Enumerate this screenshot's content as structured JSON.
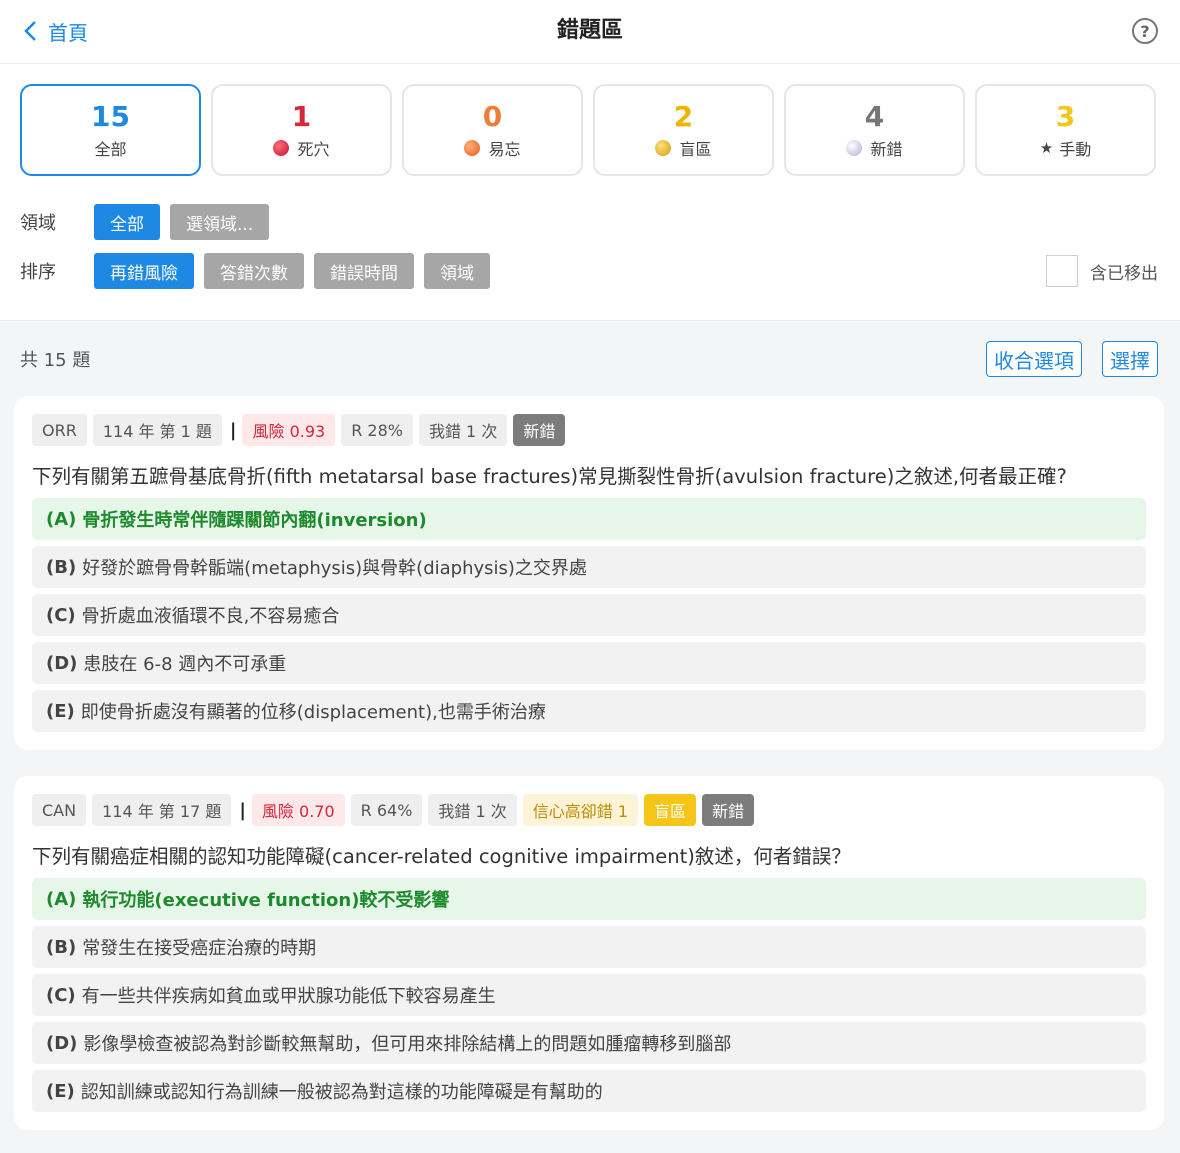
{
  "header": {
    "back_label": "首頁",
    "title": "錯題區",
    "help_glyph": "?"
  },
  "stats": [
    {
      "count": "15",
      "label": "全部",
      "color": "#1e88e5",
      "icon": "",
      "active": true
    },
    {
      "count": "1",
      "label": "死穴",
      "color": "#d8263a",
      "icon": "red-dot-icon"
    },
    {
      "count": "0",
      "label": "易忘",
      "color": "#f07b3a",
      "icon": "orange-dot-icon"
    },
    {
      "count": "2",
      "label": "盲區",
      "color": "#f0b400",
      "icon": "yellow-dot-icon"
    },
    {
      "count": "4",
      "label": "新錯",
      "color": "#777777",
      "icon": "purple-dot-icon"
    },
    {
      "count": "3",
      "label": "手動",
      "color": "#f5c518",
      "icon": "star-icon"
    }
  ],
  "filters": {
    "domain_label": "領域",
    "domain_options": [
      "全部",
      "選領域..."
    ],
    "sort_label": "排序",
    "sort_options": [
      "再錯風險",
      "答錯次數",
      "錯誤時間",
      "領域"
    ],
    "include_removed_label": "含已移出"
  },
  "list": {
    "count_text": "共 15 題",
    "collapse_label": "收合選項",
    "select_label": "選擇"
  },
  "cards": [
    {
      "tags": {
        "domain": "ORR",
        "source": "114 年 第 1 題",
        "risk": "風險 0.93",
        "r": "R 28%",
        "wrong": "我錯 1 次",
        "conf": "",
        "blind": "",
        "new": "新錯"
      },
      "question": "下列有關第五蹠骨基底骨折(fifth metatarsal base fractures)常見撕裂性骨折(avulsion fracture)之敘述,何者最正確?",
      "options": [
        {
          "key": "(A)",
          "text": "骨折發生時常伴隨踝關節內翻(inversion)"
        },
        {
          "key": "(B)",
          "text": "好發於蹠骨骨幹骺端(metaphysis)與骨幹(diaphysis)之交界處"
        },
        {
          "key": "(C)",
          "text": "骨折處血液循環不良,不容易癒合"
        },
        {
          "key": "(D)",
          "text": "患肢在 6-8 週內不可承重"
        },
        {
          "key": "(E)",
          "text": "即使骨折處沒有顯著的位移(displacement),也需手術治療"
        }
      ]
    },
    {
      "tags": {
        "domain": "CAN",
        "source": "114 年 第 17 題",
        "risk": "風險 0.70",
        "r": "R 64%",
        "wrong": "我錯 1 次",
        "conf": "信心高卻錯 1",
        "blind": "盲區",
        "new": "新錯"
      },
      "question": "下列有關癌症相關的認知功能障礙(cancer-related cognitive impairment)敘述，何者錯誤？",
      "options": [
        {
          "key": "(A)",
          "text": "執行功能(executive function)較不受影響"
        },
        {
          "key": "(B)",
          "text": "常發生在接受癌症治療的時期"
        },
        {
          "key": "(C)",
          "text": "有一些共伴疾病如貧血或甲狀腺功能低下較容易產生"
        },
        {
          "key": "(D)",
          "text": "影像學檢查被認為對診斷較無幫助，但可用來排除結構上的問題如腫瘤轉移到腦部"
        },
        {
          "key": "(E)",
          "text": "認知訓練或認知行為訓練一般被認為對這樣的功能障礙是有幫助的"
        }
      ]
    }
  ]
}
